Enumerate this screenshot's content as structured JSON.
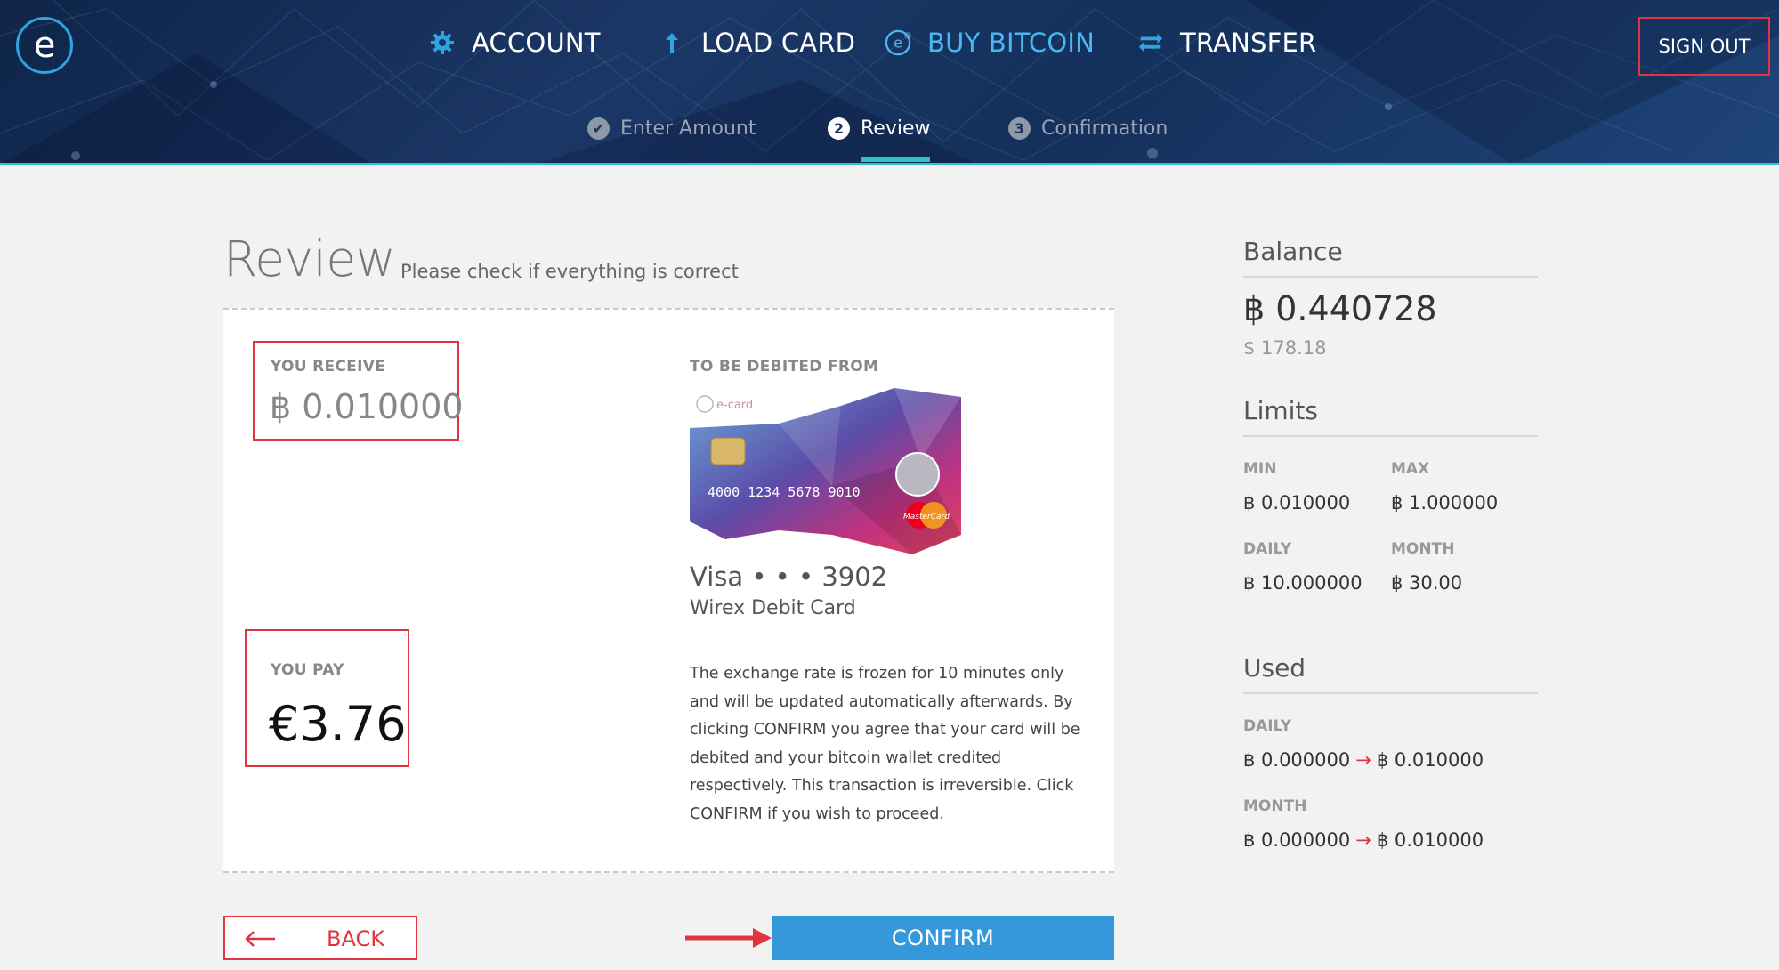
{
  "header": {
    "logo_letter": "e",
    "nav": [
      {
        "label": "ACCOUNT",
        "icon": "gear-icon",
        "active": false
      },
      {
        "label": "LOAD CARD",
        "icon": "arrow-up-icon",
        "active": false
      },
      {
        "label": "BUY BITCOIN",
        "icon": "coin-e-icon",
        "active": true
      },
      {
        "label": "TRANSFER",
        "icon": "transfer-icon",
        "active": false
      }
    ],
    "sign_out": "SIGN OUT",
    "steps": [
      {
        "number": "✔",
        "label": "Enter Amount",
        "state": "done"
      },
      {
        "number": "2",
        "label": "Review",
        "state": "active"
      },
      {
        "number": "3",
        "label": "Confirmation",
        "state": "pending"
      }
    ]
  },
  "review": {
    "title": "Review",
    "subtitle": "Please check if everything is correct",
    "you_receive_label": "YOU RECEIVE",
    "you_receive_value": "฿ 0.010000",
    "you_pay_label": "YOU PAY",
    "you_pay_value": "€3.76",
    "debited_from_label": "TO BE DEBITED FROM",
    "card": {
      "brand_line": "Visa • • • 3902",
      "name": "Wirex Debit Card",
      "logo_text": "e-card",
      "number": "4000 1234 5678 9010",
      "network": "MasterCard"
    },
    "notice": "The exchange rate is frozen for 10 minutes only and will be updated automatically afterwards. By clicking CONFIRM you agree that your card will be debited and your bitcoin wallet credited respectively. This transaction is irreversible. Click CONFIRM if you wish to proceed."
  },
  "actions": {
    "back": "BACK",
    "confirm": "CONFIRM"
  },
  "sidebar": {
    "balance": {
      "title": "Balance",
      "btc": "฿ 0.440728",
      "usd": "$ 178.18"
    },
    "limits": {
      "title": "Limits",
      "min_label": "MIN",
      "min_value": "฿ 0.010000",
      "max_label": "MAX",
      "max_value": "฿ 1.000000",
      "daily_label": "DAILY",
      "daily_value": "฿ 10.000000",
      "month_label": "MONTH",
      "month_value": "฿ 30.00"
    },
    "used": {
      "title": "Used",
      "daily_label": "DAILY",
      "daily_from": "฿ 0.000000",
      "daily_to": "฿ 0.010000",
      "month_label": "MONTH",
      "month_from": "฿ 0.000000",
      "month_to": "฿ 0.010000",
      "arrow": "→"
    }
  },
  "colors": {
    "accent_blue": "#3498db",
    "highlight_red": "#e0353e",
    "header_dark": "#14305b",
    "teal": "#2fc3c4"
  }
}
